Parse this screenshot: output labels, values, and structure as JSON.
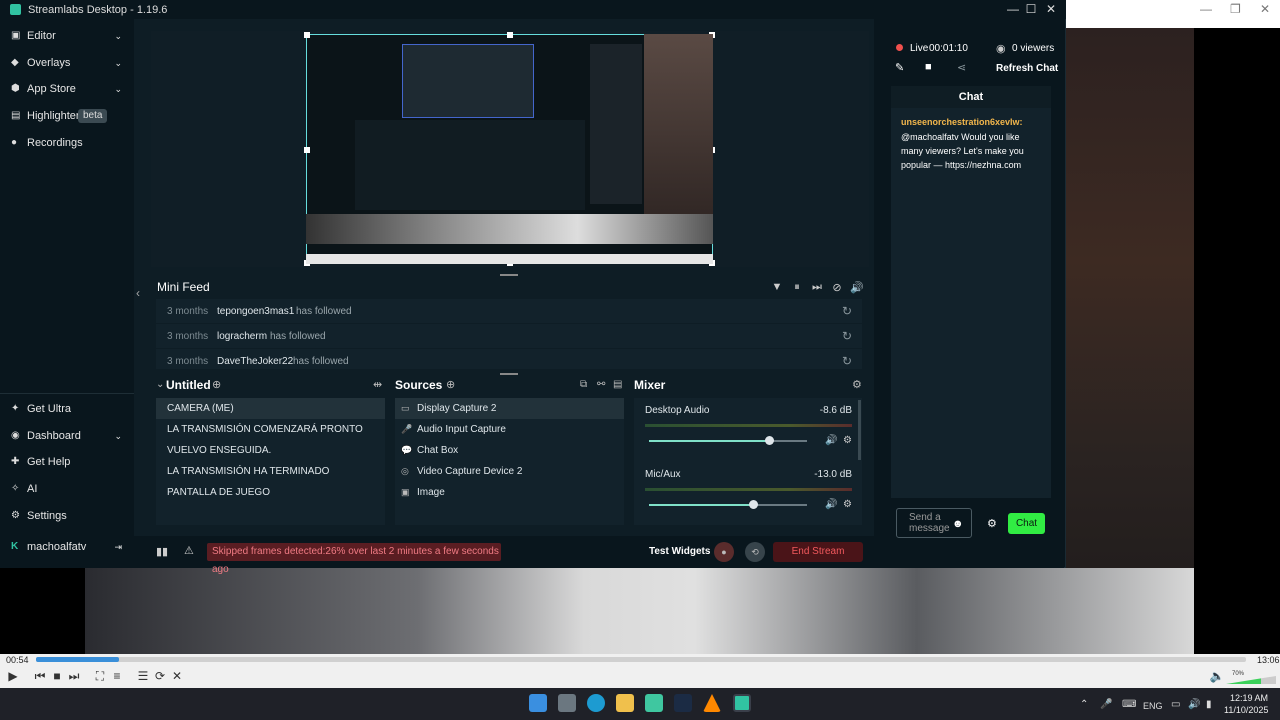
{
  "app": {
    "title": "Streamlabs Desktop - 1.19.6"
  },
  "sidebar": {
    "items": [
      {
        "label": "Editor"
      },
      {
        "label": "Overlays"
      },
      {
        "label": "App Store"
      },
      {
        "label": "Highlighter",
        "badge": "beta"
      },
      {
        "label": "Recordings"
      }
    ],
    "bottom_items": [
      {
        "label": "Get Ultra"
      },
      {
        "label": "Dashboard"
      },
      {
        "label": "Get Help"
      },
      {
        "label": "AI"
      },
      {
        "label": "Settings"
      }
    ],
    "user": "machoalfatv"
  },
  "mini_feed": {
    "title": "Mini Feed",
    "rows": [
      {
        "time": "3 months",
        "user": "tepongoen3mas1",
        "action": "has followed"
      },
      {
        "time": "3 months",
        "user": "logracherm",
        "action": "has followed"
      },
      {
        "time": "3 months",
        "user": "DaveTheJoker22",
        "action": "has followed"
      }
    ]
  },
  "scenes": {
    "title": "Untitled",
    "items": [
      {
        "label": "CAMERA (ME)"
      },
      {
        "label": "LA TRANSMISIÓN COMENZARÁ PRONTO"
      },
      {
        "label": "VUELVO ENSEGUIDA."
      },
      {
        "label": "LA TRANSMISIÓN HA TERMINADO"
      },
      {
        "label": "PANTALLA DE JUEGO"
      }
    ]
  },
  "sources": {
    "title": "Sources",
    "items": [
      {
        "label": "Display Capture 2",
        "icon": "monitor-icon"
      },
      {
        "label": "Audio Input Capture",
        "icon": "microphone-icon"
      },
      {
        "label": "Chat Box",
        "icon": "chat-icon"
      },
      {
        "label": "Video Capture Device 2",
        "icon": "webcam-icon"
      },
      {
        "label": "Image",
        "icon": "image-icon"
      }
    ]
  },
  "mixer": {
    "title": "Mixer",
    "channels": [
      {
        "label": "Desktop Audio",
        "db": "-8.6 dB",
        "level": 0.76
      },
      {
        "label": "Mic/Aux",
        "db": "-13.0 dB",
        "level": 0.66
      }
    ]
  },
  "footer": {
    "warning": "Skipped frames detected:26% over last 2 minutes a few seconds ago",
    "test_widgets": "Test Widgets",
    "end_stream": "End Stream"
  },
  "live": {
    "status": "Live",
    "time": "00:01:10",
    "viewers": "0 viewers",
    "refresh": "Refresh Chat"
  },
  "chat": {
    "title": "Chat",
    "message_user": "unseenorchestration6xevlw:",
    "message_text": "@machoalfatv Would you like many viewers? Let's make you popular — https://nezhna.com",
    "input_placeholder": "Send a message",
    "button": "Chat"
  },
  "player": {
    "current_time": "00:54",
    "total_time": "13:06",
    "progress": 0.069,
    "volume": "70%"
  },
  "taskbar": {
    "lang": "ENG",
    "time": "12:19 AM",
    "date": "11/10/2025"
  },
  "colors": {
    "accent": "#31c3a2",
    "live_red": "#f0504d",
    "chat_green": "#31ec43",
    "end_stream_red": "#f2595d"
  }
}
